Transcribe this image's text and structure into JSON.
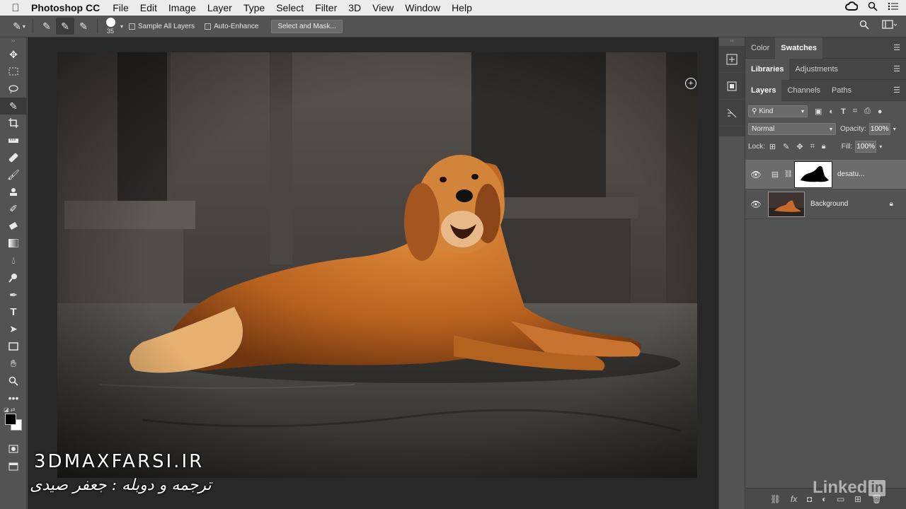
{
  "menubar": {
    "app_name": "Photoshop CC",
    "items": [
      "File",
      "Edit",
      "Image",
      "Layer",
      "Type",
      "Select",
      "Filter",
      "3D",
      "View",
      "Window",
      "Help"
    ],
    "right_icons": [
      "creative-cloud-icon",
      "spotlight-search-icon",
      "notification-list-icon"
    ]
  },
  "options_bar": {
    "brush_size": "35",
    "sample_all_layers_label": "Sample All Layers",
    "sample_all_layers_checked": false,
    "auto_enhance_label": "Auto-Enhance",
    "auto_enhance_checked": false,
    "select_and_mask_label": "Select and Mask..."
  },
  "toolbar": {
    "tools": [
      "move-tool-icon",
      "marquee-tool-icon",
      "lasso-tool-icon",
      "quick-selection-tool-icon",
      "crop-tool-icon",
      "ruler-tool-icon",
      "healing-brush-tool-icon",
      "brush-tool-icon",
      "clone-stamp-tool-icon",
      "history-brush-tool-icon",
      "eraser-tool-icon",
      "gradient-tool-icon",
      "blur-tool-icon",
      "dodge-tool-icon",
      "pen-tool-icon",
      "type-tool-icon",
      "path-selection-tool-icon",
      "rectangle-tool-icon",
      "hand-tool-icon",
      "zoom-tool-icon",
      "more-tools-icon"
    ],
    "active_tool": "quick-selection-tool-icon",
    "foreground_color": "#000000",
    "background_color": "#ffffff"
  },
  "panels": {
    "group1_tabs": [
      "Color",
      "Swatches"
    ],
    "group1_active": "Swatches",
    "group2_tabs": [
      "Libraries",
      "Adjustments"
    ],
    "group2_active": "Libraries",
    "group3_tabs": [
      "Layers",
      "Channels",
      "Paths"
    ],
    "group3_active": "Layers",
    "filter_kind": "Kind",
    "blend_mode": "Normal",
    "opacity_label": "Opacity:",
    "opacity_value": "100%",
    "lock_label": "Lock:",
    "fill_label": "Fill:",
    "fill_value": "100%",
    "layers": [
      {
        "name": "desatu...",
        "visible": true,
        "active": true,
        "type": "adjustment"
      },
      {
        "name": "Background",
        "visible": true,
        "active": false,
        "locked": true
      }
    ]
  },
  "watermarks": {
    "site": "3DMAXFARSI.IR",
    "credit": "ترجمه و دوبله : جعفر صیدی",
    "brand": "Linked",
    "brand_in": "in"
  }
}
